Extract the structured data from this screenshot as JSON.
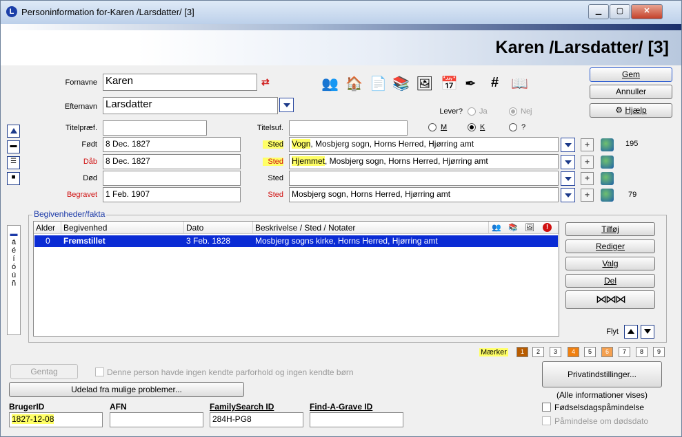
{
  "window": {
    "title": "Personinformation for-Karen /Larsdatter/ [3]",
    "app_icon_letter": "L",
    "controls": {
      "minimize": "▭",
      "maximize": "▣",
      "close": "✕"
    }
  },
  "header": {
    "person_name": "Karen /Larsdatter/ [3]"
  },
  "buttons": {
    "save": "Gem",
    "cancel": "Annuller",
    "help": "Hjælp",
    "repeat": "Gentag",
    "check_problems": "Udelad fra mulige problemer...",
    "privacy": "Privatindstillinger...",
    "add": "Tilføj",
    "edit": "Rediger",
    "options": "Valg",
    "share": "Del",
    "move_label": "Flyt"
  },
  "name": {
    "given_label": "Fornavne",
    "given_value": "Karen",
    "surname_label": "Efternavn",
    "surname_value": "Larsdatter",
    "prefix_label": "Titelpræf.",
    "prefix_value": "",
    "suffix_label": "Titelsuf.",
    "suffix_value": ""
  },
  "living": {
    "label": "Lever?",
    "yes": "Ja",
    "no": "Nej",
    "selected": "Nej"
  },
  "sex": {
    "m": "M",
    "k": "K",
    "unknown": "?",
    "selected": "K"
  },
  "events": [
    {
      "label": "Født",
      "date": "8 Dec. 1827",
      "place_label": "Sted",
      "place_hl": "Vogn",
      "place_rest": ", Mosbjerg sogn, Horns Herred, Hjørring amt",
      "count": "195"
    },
    {
      "label": "Dåb",
      "date": "8 Dec. 1827",
      "place_label": "Sted",
      "place_hl": "Hjemmet",
      "place_rest": ", Mosbjerg sogn, Horns Herred, Hjørring amt",
      "count": ""
    },
    {
      "label": "Død",
      "date": "",
      "place_label": "Sted",
      "place_hl": "",
      "place_rest": "",
      "count": ""
    },
    {
      "label": "Begravet",
      "date": "1 Feb. 1907",
      "place_label": "Sted",
      "place_hl": "",
      "place_rest": "Mosbjerg sogn, Horns Herred, Hjørring amt",
      "count": "79"
    }
  ],
  "facts": {
    "group_title": "Begivenheder/fakta",
    "columns": [
      "Alder",
      "Begivenhed",
      "Dato",
      "Beskrivelse / Sted / Notater"
    ],
    "rows": [
      {
        "age": "0",
        "event": "Fremstillet",
        "date": "3 Feb. 1828",
        "desc": "Mosbjerg sogns kirke, Horns Herred, Hjørring amt"
      }
    ]
  },
  "accent_chars": [
    "á",
    "é",
    "í",
    "ó",
    "ú",
    "ñ"
  ],
  "markers": {
    "label": "Mærker",
    "items": [
      "1",
      "2",
      "3",
      "4",
      "5",
      "6",
      "7",
      "8",
      "9"
    ],
    "colors": {
      "1": "#b85c00",
      "4": "#f08010",
      "6": "#f4a050"
    }
  },
  "no_family_text": "Denne person havde ingen kendte parforhold og ingen kendte børn",
  "all_info_shown": "(Alle informationer vises)",
  "birthday_reminder": "Fødselsdagspåmindelse",
  "death_reminder": "Påmindelse om dødsdato",
  "ids": {
    "user_id_label": "BrugerID",
    "user_id_value": "1827-12-08",
    "afn_label": "AFN",
    "afn_value": "",
    "familysearch_label": "FamilySearch ID",
    "familysearch_value": "284H-PG8",
    "findagrave_label": "Find-A-Grave ID",
    "findagrave_value": ""
  },
  "dna_icon": "dna-icon"
}
